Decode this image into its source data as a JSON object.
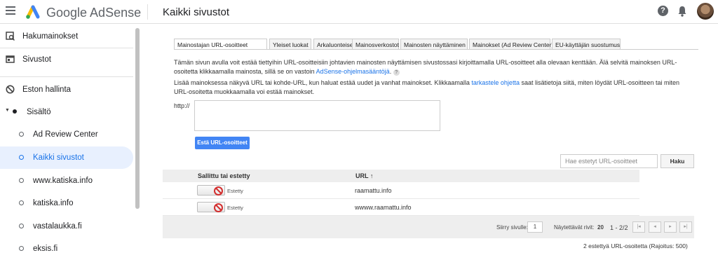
{
  "header": {
    "brand": "Google AdSense",
    "title": "Kaikki sivustot",
    "help": "?"
  },
  "sidebar": {
    "items": [
      {
        "label": "Hakumainokset"
      },
      {
        "label": "Sivustot"
      },
      {
        "label": "Eston hallinta"
      },
      {
        "label": "Sisältö"
      },
      {
        "label": "Ad Review Center"
      },
      {
        "label": "Kaikki sivustot"
      },
      {
        "label": "www.katiska.info"
      },
      {
        "label": "katiska.info"
      },
      {
        "label": "vastalaukka.fi"
      },
      {
        "label": "eksis.fi"
      }
    ]
  },
  "tabs": [
    "Mainostajan URL-osoitteet",
    "Yleiset luokat",
    "Arkaluonteiset luokat",
    "Mainosverkostot",
    "Mainosten näyttäminen",
    "Mainokset (Ad Review Center)",
    "EU-käyttäjän suostumus"
  ],
  "text": {
    "p1a": "Tämän sivun avulla voit estää tiettyihin URL-osoitteisiin johtavien mainosten näyttämisen sivustossasi kirjoittamalla URL-osoitteet alla olevaan kenttään. Älä selvitä mainoksen URL-osoitetta klikkaamalla mainosta, sillä se on vastoin ",
    "p1link": "AdSense-ohjelmasääntöjä",
    "p1b": ".",
    "p2a": "Lisää mainoksessa näkyvä URL tai kohde-URL, kun haluat estää uudet ja vanhat mainokset. Klikkaamalla ",
    "p2link": "tarkastele ohjetta",
    "p2b": " saat lisätietoja siitä, miten löydät URL-osoitteen tai miten URL-osoitetta muokkaamalla voi estää mainokset.",
    "http": "http://",
    "block_btn": "Estä URL-osoitteet",
    "search_placeholder": "Hae estetyt URL-osoitteet",
    "search_btn": "Haku"
  },
  "table": {
    "col1": "Sallittu tai estetty",
    "col2": "URL ↑",
    "rows": [
      {
        "status": "Estetty",
        "url": "raamattu.info"
      },
      {
        "status": "Estetty",
        "url": "wwww.raamattu.info"
      }
    ]
  },
  "pager": {
    "goto": "Siirry sivulle:",
    "page": "1",
    "rows_label": "Näytettävät rivit:",
    "rows": "20",
    "range": "1 - 2/2"
  },
  "footer": "2 estettyä URL-osoitetta (Rajoitus: 500)"
}
